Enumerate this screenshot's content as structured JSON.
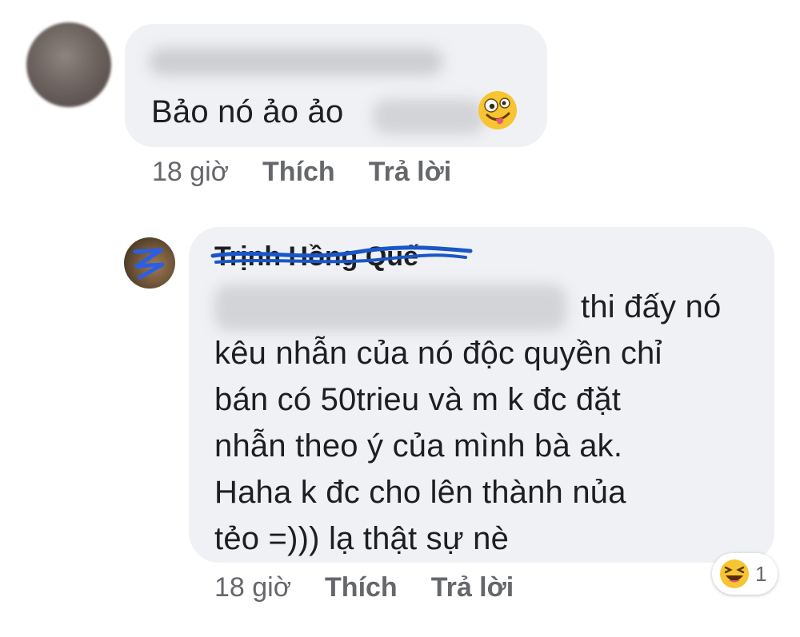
{
  "comments": [
    {
      "text": "Bảo nó ảo ảo",
      "emoji": "zany-face-emoji",
      "meta": {
        "time": "18 giờ",
        "like": "Thích",
        "reply": "Trả lời"
      }
    },
    {
      "author": "Trịnh Hồng Quế",
      "lines": [
        "thi đấy nó",
        "kêu nhẫn của nó độc quyền chỉ",
        "bán có 50trieu và m k đc đặt",
        "nhẫn theo ý của mình bà ak.",
        "Haha k đc cho lên thành nủa",
        "tẻo =))) lạ thật sự nè"
      ],
      "meta": {
        "time": "18 giờ",
        "like": "Thích",
        "reply": "Trả lời"
      },
      "reaction": {
        "icon": "laughing-emoji",
        "count": "1"
      }
    }
  ],
  "colors": {
    "bubble": "#eff1f4",
    "meta": "#65676b",
    "text": "#1c1e21",
    "strike": "#1a56c8"
  }
}
